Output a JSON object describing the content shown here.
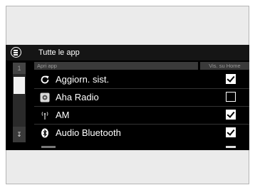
{
  "header": {
    "title": "Tutte le app"
  },
  "columns": {
    "left": "Apri app",
    "right": "Vis. su Home"
  },
  "scrollbar": {
    "indicator": "1"
  },
  "rows": [
    {
      "label": "Aggiorn. sist.",
      "icon": "refresh-icon",
      "checked": true
    },
    {
      "label": "Aha Radio",
      "icon": "aha-radio-icon",
      "checked": false
    },
    {
      "label": "AM",
      "icon": "radio-tower-icon",
      "checked": true
    },
    {
      "label": "Audio Bluetooth",
      "icon": "bluetooth-icon",
      "checked": true
    }
  ],
  "colors": {
    "screen_bg": "#000000",
    "header_bg": "#151515",
    "text": "#ffffff"
  }
}
